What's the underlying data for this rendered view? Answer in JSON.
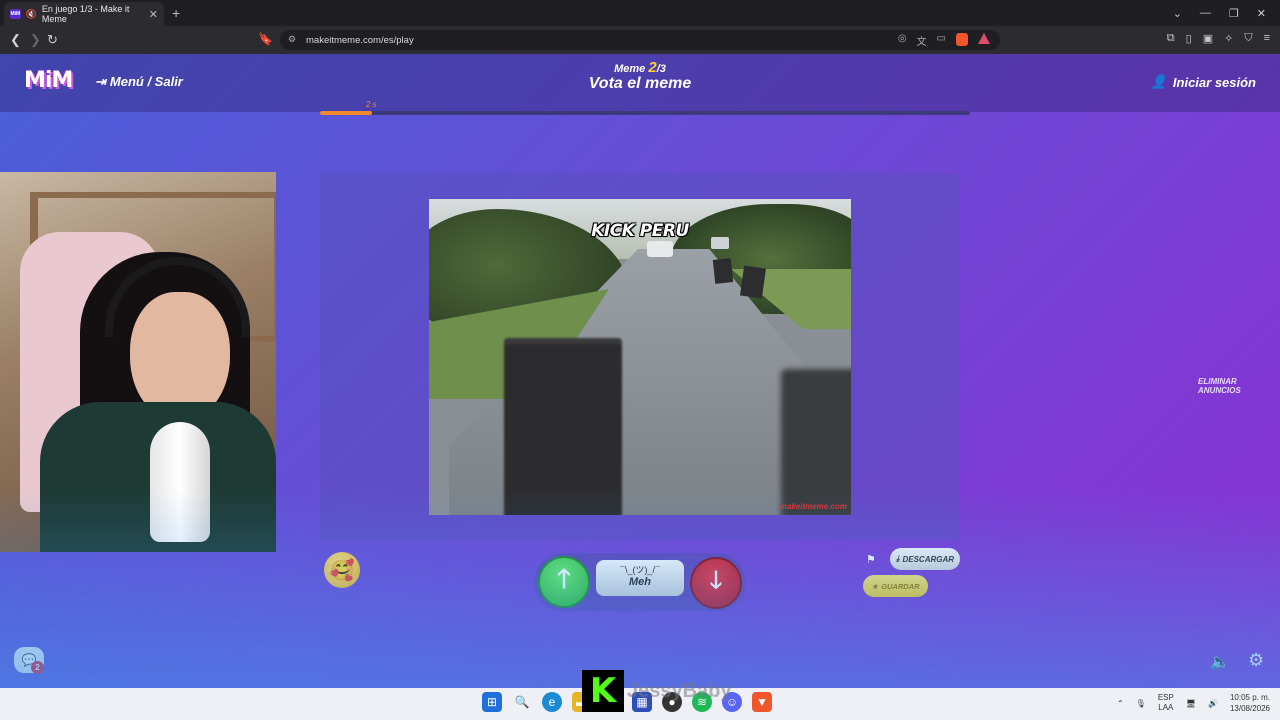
{
  "browser": {
    "tab_title": "En juego 1/3 - Make it Meme",
    "tab_favicon": "MiM",
    "url": "makeitmeme.com/es/play"
  },
  "app": {
    "logo": "MiM",
    "menu_label": "Menú / Salir",
    "meme_prefix": "Meme",
    "meme_current": "2",
    "meme_total": "/3",
    "page_title": "Vota el meme",
    "login_label": "Iniciar sesión",
    "timer_label": "2 s",
    "timer_progress": 0.08,
    "accent_color": "#f08a2c"
  },
  "meme": {
    "caption": "KICK PERU",
    "watermark": "makeitmeme.com"
  },
  "voting": {
    "meh_shrug": "¯\\_(ツ)_/¯",
    "meh_label": "Meh",
    "up_icon": "arrow-up-icon",
    "down_icon": "arrow-down-icon",
    "up_color": "#2bbf32",
    "down_color": "#d01529"
  },
  "actions": {
    "download_label": "DESCARGAR",
    "save_label": "GUARDAR",
    "remove_ads_label": "ELIMINAR ANUNCIOS"
  },
  "chat": {
    "badge_count": "2"
  },
  "stream_overlay": {
    "kick_logo": "K",
    "streamer_name": "JessyBaby"
  },
  "taskbar": {
    "lang_line1": "ESP",
    "lang_line2": "LAA",
    "time": "10:05 p. m.",
    "date": "13/08/2026"
  }
}
